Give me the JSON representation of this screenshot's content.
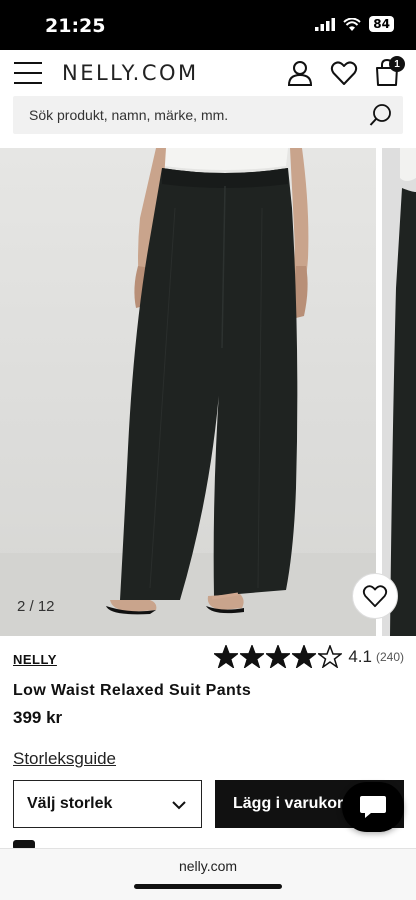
{
  "status": {
    "time": "21:25",
    "battery": "84"
  },
  "header": {
    "logo": "NELLY.COM",
    "cart_count": "1"
  },
  "search": {
    "placeholder": "Sök produkt, namn, märke, mm."
  },
  "gallery": {
    "counter": "2 / 12"
  },
  "product": {
    "brand": "NELLY",
    "title": "Low Waist Relaxed Suit Pants",
    "price": "399 kr",
    "rating": "4.1",
    "rating_count": "(240)",
    "stars_filled": 4.1,
    "stars_total": 5
  },
  "actions": {
    "size_guide": "Storleksguide",
    "select_size": "Välj storlek",
    "add_to_cart": "Lägg i varukorg"
  },
  "browser": {
    "url": "nelly.com"
  },
  "colors": {
    "accent": "#111111",
    "search_bg": "#f1f1f1",
    "product_fabric": "#1f2321"
  },
  "icons": [
    "hamburger-icon",
    "user-icon",
    "heart-icon",
    "bag-icon",
    "search-icon",
    "star-icon",
    "chevron-down-icon",
    "chat-icon"
  ]
}
